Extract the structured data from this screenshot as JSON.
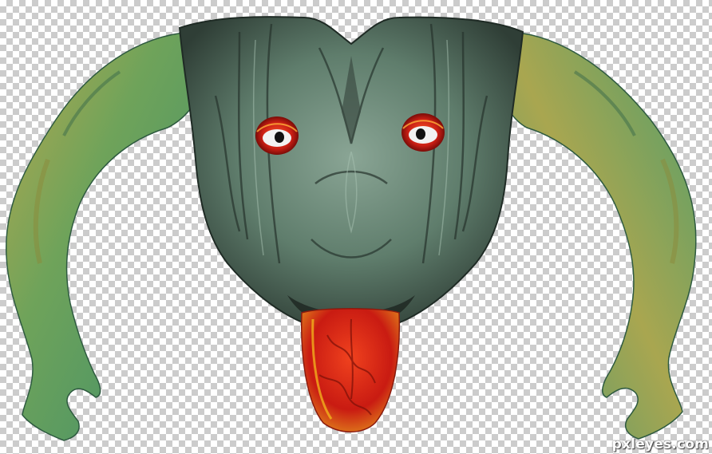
{
  "image": {
    "subject": "creature-photomanipulation",
    "background": "transparency-checkerboard",
    "watermark": "pxleyes.com"
  },
  "colors": {
    "checker_light": "#ffffff",
    "checker_dark": "#cccccc",
    "stone_green": "#5f7d6c",
    "stone_dark": "#2f3e36",
    "arm_green": "#4f9e6b",
    "arm_yellow": "#b7a84e",
    "eye_red": "#d42a1a",
    "tongue_red": "#e0281a"
  },
  "icons": {
    "watermark": "pxleyes-logo-text"
  }
}
